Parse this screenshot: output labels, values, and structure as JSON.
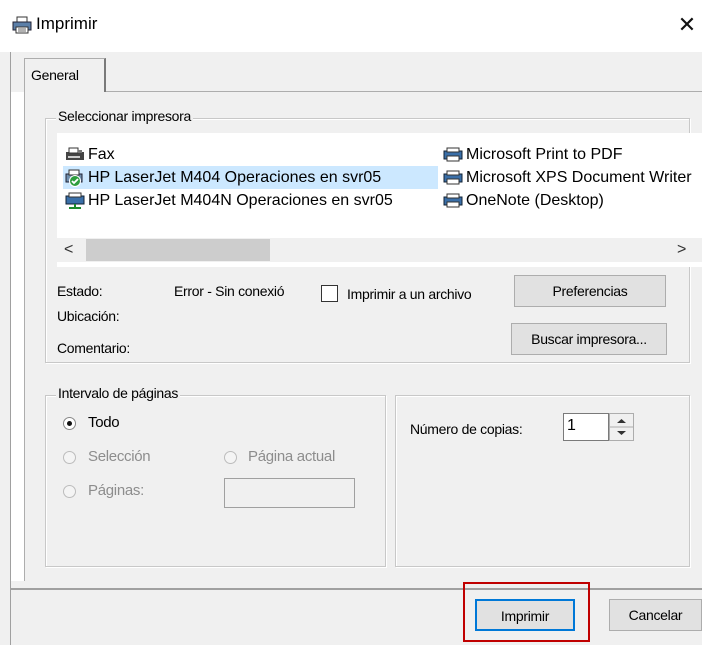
{
  "window": {
    "title": "Imprimir",
    "close_glyph": "✕"
  },
  "tabs": [
    {
      "label": "General",
      "selected": true
    }
  ],
  "printer_group": {
    "legend": "Seleccionar impresora",
    "printers_col1": [
      {
        "name": "Fax",
        "icon": "fax-printer-icon",
        "selected": false
      },
      {
        "name": "HP LaserJet M404 Operaciones en svr05",
        "icon": "default-printer-check-icon",
        "selected": true
      },
      {
        "name": "HP LaserJet M404N Operaciones en svr05",
        "icon": "network-printer-icon",
        "selected": false
      }
    ],
    "printers_col2": [
      {
        "name": "Microsoft Print to PDF",
        "icon": "printer-icon"
      },
      {
        "name": "Microsoft XPS Document Writer",
        "icon": "printer-icon"
      },
      {
        "name": "OneNote (Desktop)",
        "icon": "printer-icon"
      }
    ],
    "scroll_left": "<",
    "scroll_right": ">",
    "status_label": "Estado:",
    "status_value": "Error - Sin conexió",
    "location_label": "Ubicación:",
    "comment_label": "Comentario:",
    "print_to_file_label": "Imprimir a un archivo",
    "print_to_file_checked": false,
    "preferences_button": "Preferencias",
    "find_printer_button": "Buscar impresora..."
  },
  "range_group": {
    "legend": "Intervalo de páginas",
    "all_label": "Todo",
    "selection_label": "Selección",
    "current_page_label": "Página actual",
    "pages_label": "Páginas:",
    "selected_option": "Todo"
  },
  "copies": {
    "label": "Número de copias:",
    "value": "1"
  },
  "buttons": {
    "print": "Imprimir",
    "cancel": "Cancelar"
  },
  "colors": {
    "selection": "#cce8ff",
    "highlight_border": "#c00000",
    "dialog_bg": "#f0f0f0"
  }
}
